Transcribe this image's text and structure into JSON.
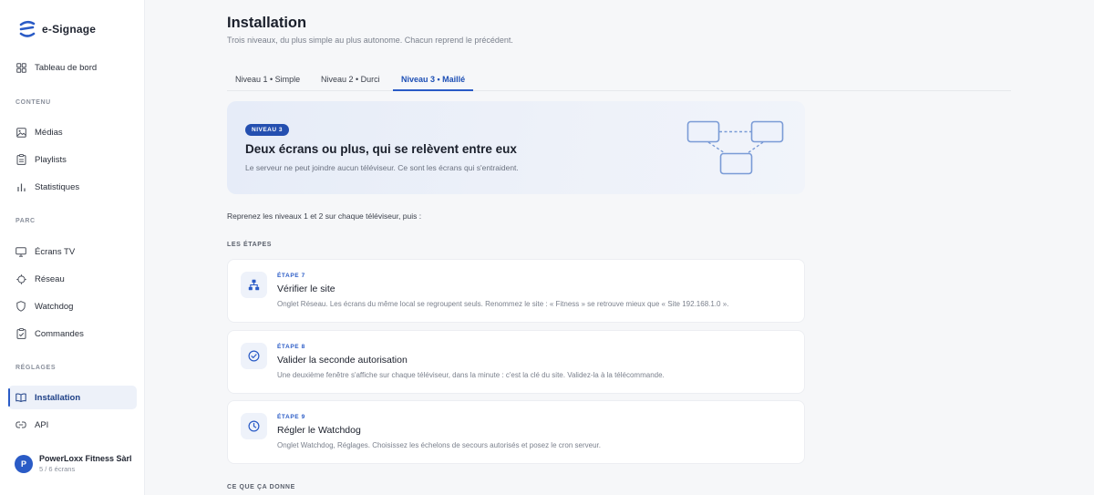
{
  "app": {
    "name": "e-Signage"
  },
  "sidebar": {
    "dashboard": "Tableau de bord",
    "sections": {
      "contenu": "CONTENU",
      "parc": "PARC",
      "reglages": "RÉGLAGES"
    },
    "items": {
      "medias": "Médias",
      "playlists": "Playlists",
      "statistiques": "Statistiques",
      "ecrans": "Écrans TV",
      "reseau": "Réseau",
      "watchdog": "Watchdog",
      "commandes": "Commandes",
      "installation": "Installation",
      "api": "API"
    },
    "account": {
      "initial": "P",
      "name": "PowerLoxx Fitness Sàrl",
      "sub": "5 / 6 écrans"
    }
  },
  "page": {
    "title": "Installation",
    "subtitle": "Trois niveaux, du plus simple au plus autonome. Chacun reprend le précédent."
  },
  "tabs": [
    {
      "label": "Niveau 1 • Simple"
    },
    {
      "label": "Niveau 2 • Durci"
    },
    {
      "label": "Niveau 3 • Maillé"
    }
  ],
  "hero": {
    "badge": "NIVEAU 3",
    "title": "Deux écrans ou plus, qui se relèvent entre eux",
    "description": "Le serveur ne peut joindre aucun téléviseur. Ce sont les écrans qui s'entraident."
  },
  "intro": "Reprenez les niveaux 1 et 2 sur chaque téléviseur, puis :",
  "steps_label": "LES ÉTAPES",
  "steps": [
    {
      "kicker": "ÉTAPE 7",
      "title": "Vérifier le site",
      "description": "Onglet Réseau. Les écrans du même local se regroupent seuls. Renommez le site : « Fitness » se retrouve mieux que « Site 192.168.1.0 ».",
      "icon": "network-icon"
    },
    {
      "kicker": "ÉTAPE 8",
      "title": "Valider la seconde autorisation",
      "description": "Une deuxième fenêtre s'affiche sur chaque téléviseur, dans la minute : c'est la clé du site. Validez-la à la télécommande.",
      "icon": "check-circle-icon"
    },
    {
      "kicker": "ÉTAPE 9",
      "title": "Régler le Watchdog",
      "description": "Onglet Watchdog, Réglages. Choisissez les échelons de secours autorisés et posez le cron serveur.",
      "icon": "clock-icon"
    }
  ],
  "result_label": "CE QUE ÇA DONNE",
  "colors": {
    "accent": "#2a5bc6",
    "badge": "#244fb0",
    "hero_bg": "#e8eef9",
    "sidebar_active_bg": "#edf1f9"
  }
}
